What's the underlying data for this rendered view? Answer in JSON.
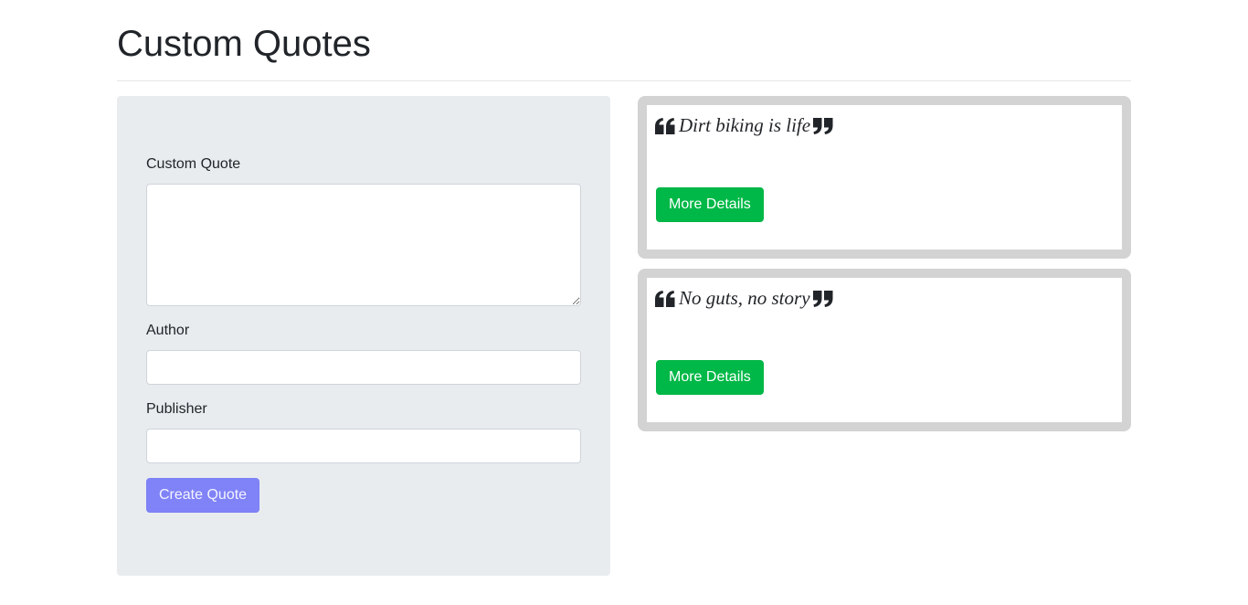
{
  "page": {
    "title": "Custom Quotes"
  },
  "form": {
    "quote_label": "Custom Quote",
    "quote_value": "",
    "author_label": "Author",
    "author_value": "",
    "publisher_label": "Publisher",
    "publisher_value": "",
    "submit_label": "Create Quote"
  },
  "quotes": [
    {
      "text": "Dirt biking is life",
      "button_label": "More Details"
    },
    {
      "text": "No guts, no story",
      "button_label": "More Details"
    }
  ],
  "icons": {
    "open_quote": "quote-left-icon",
    "close_quote": "quote-right-icon"
  },
  "colors": {
    "form_background": "#e9ecef",
    "primary_button": "#8083f7",
    "success_button": "#00b847",
    "card_border": "#d3d3d3",
    "text": "#212529"
  }
}
